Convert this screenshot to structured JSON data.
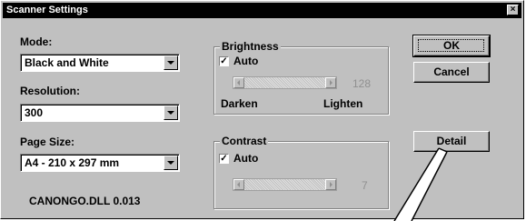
{
  "window": {
    "title": "Scanner Settings",
    "close_symbol": "×"
  },
  "mode": {
    "label": "Mode:",
    "value": "Black and White"
  },
  "resolution": {
    "label": "Resolution:",
    "value": "300"
  },
  "page_size": {
    "label": "Page Size:",
    "value": "A4 - 210 x 297 mm"
  },
  "brightness": {
    "title": "Brightness",
    "auto_label": "Auto",
    "auto_checked": true,
    "value": "128",
    "min_label": "Darken",
    "max_label": "Lighten"
  },
  "contrast": {
    "title": "Contrast",
    "auto_label": "Auto",
    "auto_checked": true,
    "value": "7"
  },
  "buttons": {
    "ok": "OK",
    "cancel": "Cancel",
    "detail": "Detail"
  },
  "version_text": "CANONGO.DLL 0.013",
  "checkmark": "✓"
}
